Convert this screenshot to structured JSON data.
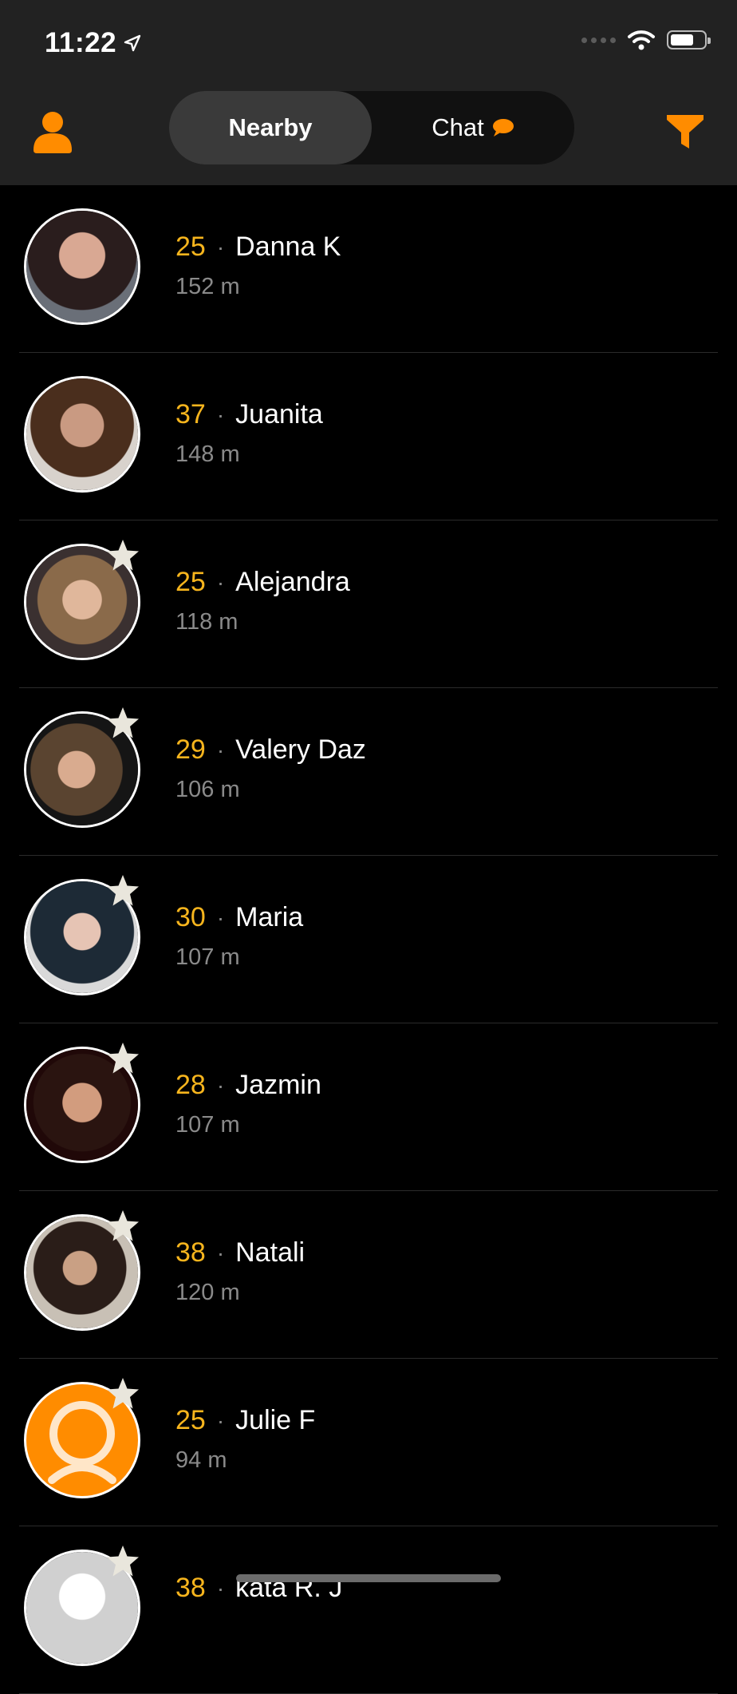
{
  "status": {
    "time": "11:22"
  },
  "tabs": {
    "nearby": "Nearby",
    "chat": "Chat"
  },
  "colors": {
    "accent": "#ff8c00",
    "age": "#f7b51d",
    "background": "#000000"
  },
  "people": [
    {
      "age": "25",
      "name": "Danna K",
      "distance": "152 m",
      "starred": false
    },
    {
      "age": "37",
      "name": "Juanita",
      "distance": "148 m",
      "starred": false
    },
    {
      "age": "25",
      "name": "Alejandra",
      "distance": "118 m",
      "starred": true
    },
    {
      "age": "29",
      "name": "Valery Daz",
      "distance": "106 m",
      "starred": true
    },
    {
      "age": "30",
      "name": "Maria",
      "distance": "107 m",
      "starred": true
    },
    {
      "age": "28",
      "name": "Jazmin",
      "distance": "107 m",
      "starred": true
    },
    {
      "age": "38",
      "name": "Natali",
      "distance": "120 m",
      "starred": true
    },
    {
      "age": "25",
      "name": "Julie F",
      "distance": "94 m",
      "starred": true
    },
    {
      "age": "38",
      "name": "kata R. J",
      "distance": "",
      "starred": true
    }
  ]
}
